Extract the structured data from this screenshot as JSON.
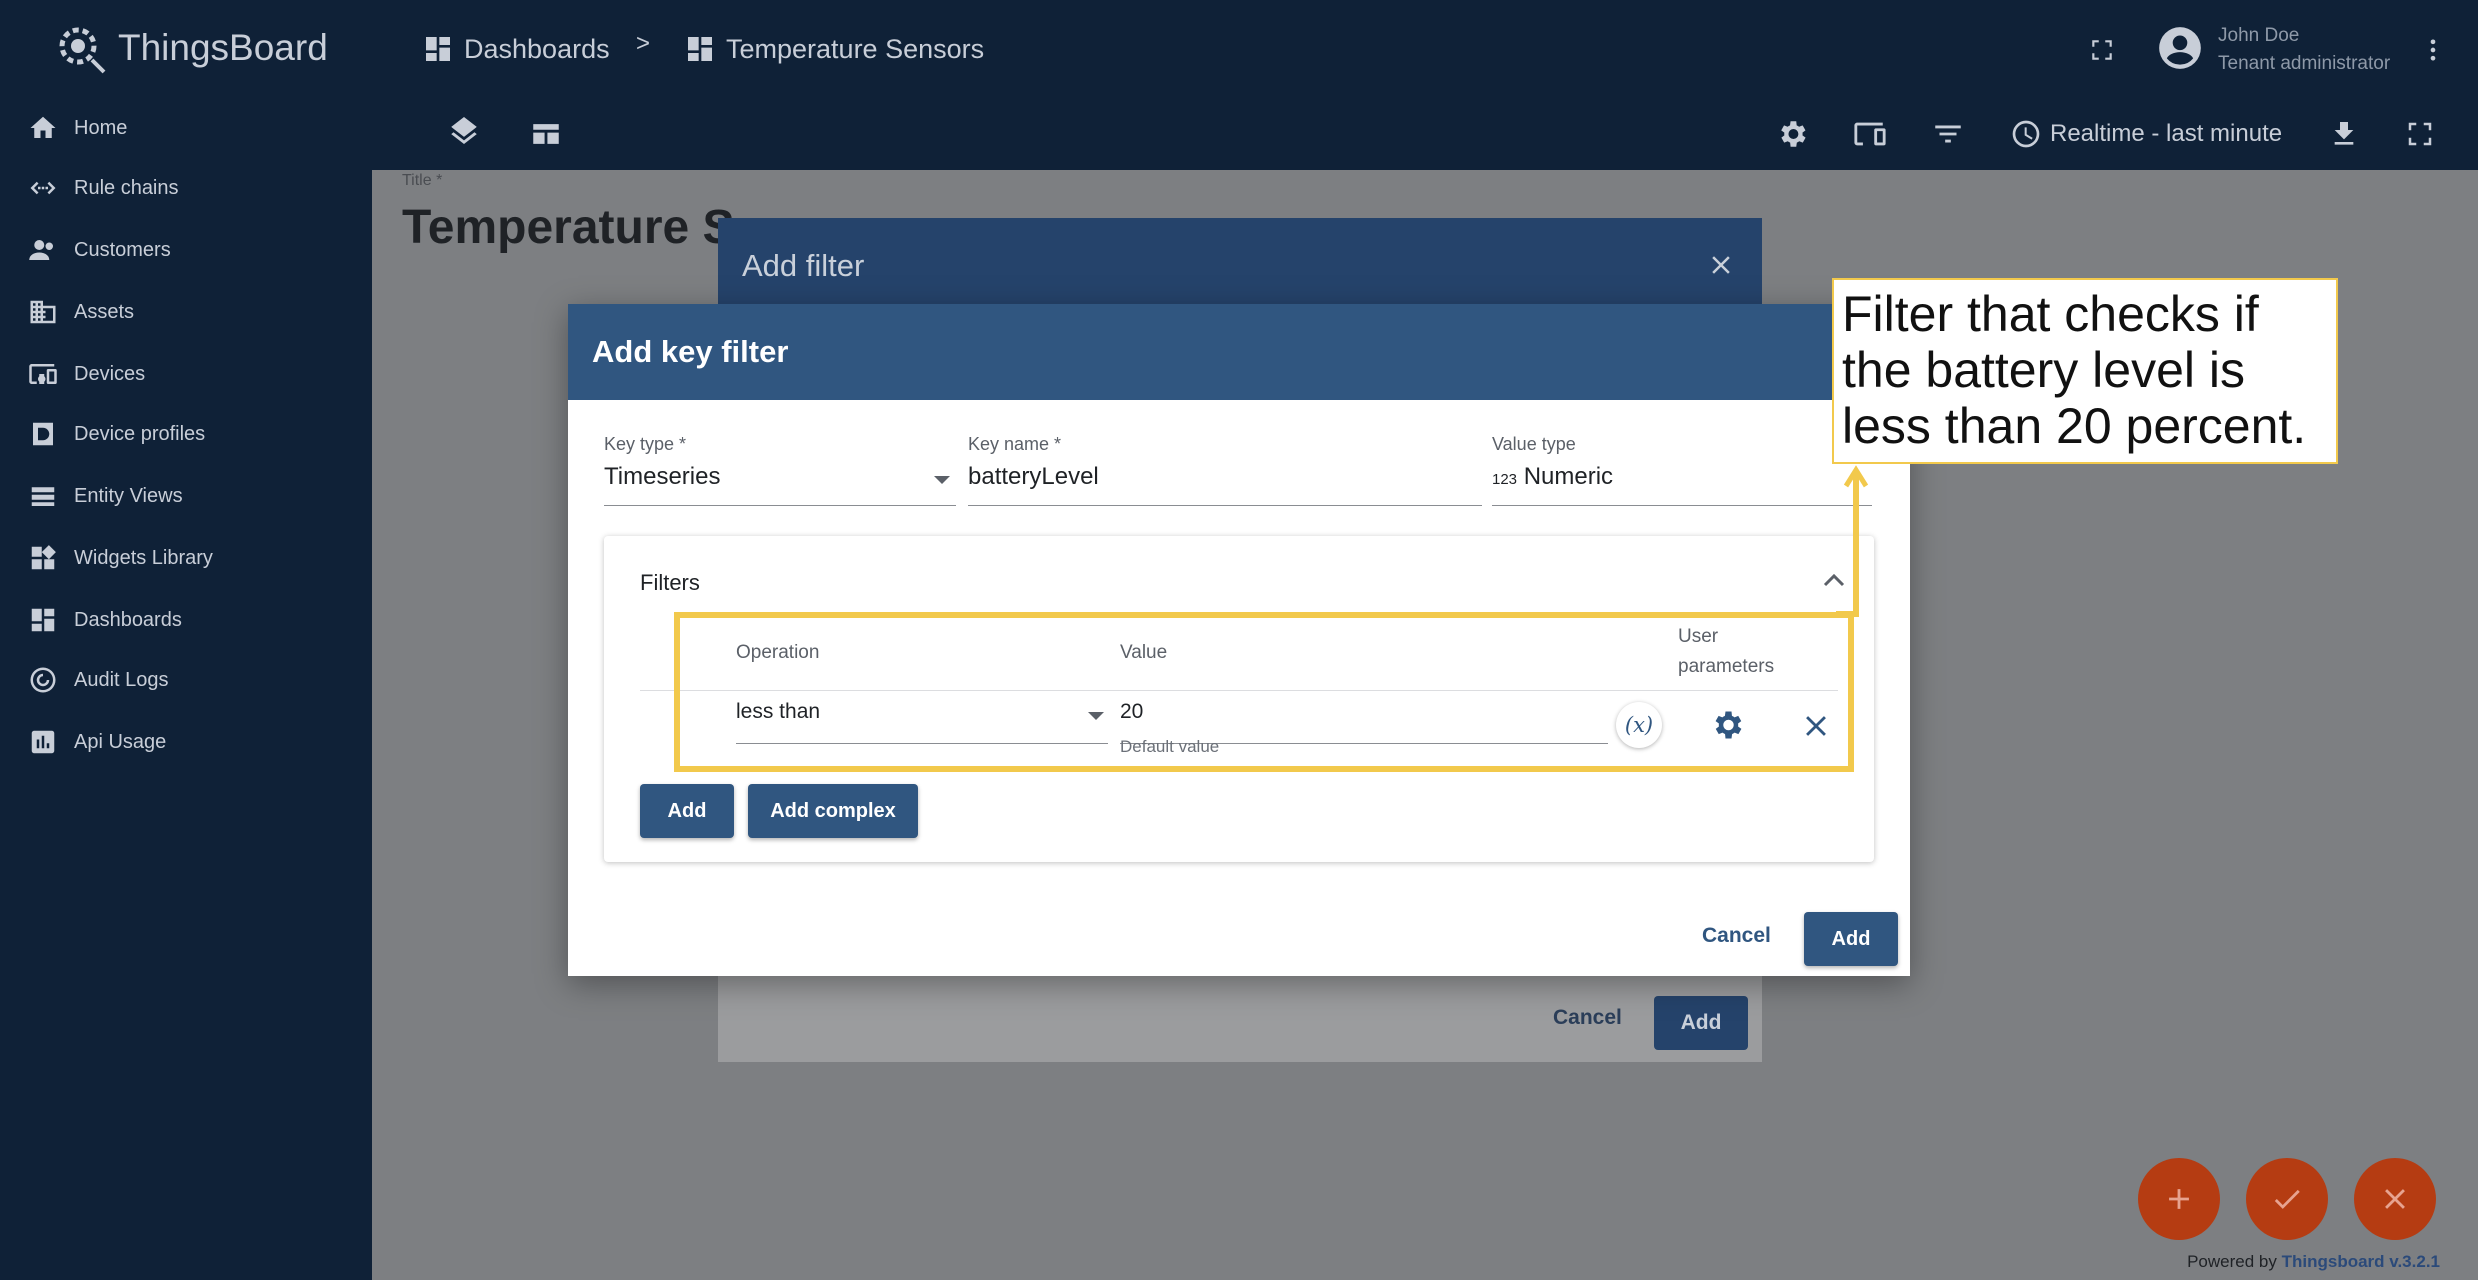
{
  "app": {
    "name": "ThingsBoard"
  },
  "sidebar": {
    "items": [
      {
        "label": "Home",
        "icon": "home-icon"
      },
      {
        "label": "Rule chains",
        "icon": "rule-chains-icon"
      },
      {
        "label": "Customers",
        "icon": "customers-icon"
      },
      {
        "label": "Assets",
        "icon": "assets-icon"
      },
      {
        "label": "Devices",
        "icon": "devices-icon"
      },
      {
        "label": "Device profiles",
        "icon": "device-profiles-icon"
      },
      {
        "label": "Entity Views",
        "icon": "entity-views-icon"
      },
      {
        "label": "Widgets Library",
        "icon": "widgets-icon"
      },
      {
        "label": "Dashboards",
        "icon": "dashboards-icon"
      },
      {
        "label": "Audit Logs",
        "icon": "audit-logs-icon"
      },
      {
        "label": "Api Usage",
        "icon": "api-usage-icon"
      }
    ]
  },
  "header": {
    "breadcrumb": [
      "Dashboards",
      "Temperature Sensors"
    ],
    "separator": ">",
    "user": {
      "name": "John Doe",
      "role": "Tenant administrator"
    },
    "timewindow": "Realtime - last minute"
  },
  "dashboard": {
    "title_label": "Title *",
    "title_value": "Temperature S"
  },
  "back_dialog": {
    "title": "Add filter",
    "cancel": "Cancel",
    "add": "Add"
  },
  "key_filter_dialog": {
    "title": "Add key filter",
    "key_type": {
      "label": "Key type *",
      "value": "Timeseries"
    },
    "key_name": {
      "label": "Key name *",
      "value": "batteryLevel"
    },
    "value_type": {
      "label": "Value type",
      "prefix": "123",
      "value": "Numeric"
    },
    "filters": {
      "title": "Filters",
      "columns": {
        "operation": "Operation",
        "value": "Value",
        "user_params": "User parameters"
      },
      "row": {
        "operation": "less than",
        "value": "20",
        "hint": "Default value",
        "dynamic_label": "(x)"
      },
      "add": "Add",
      "add_complex": "Add complex"
    },
    "cancel": "Cancel",
    "add": "Add"
  },
  "annotation": {
    "text": "Filter that checks if the battery level is less than 20 percent."
  },
  "footer": {
    "powered_prefix": "Powered by",
    "powered_link": "Thingsboard v.3.2.1"
  },
  "colors": {
    "primary": "#305680",
    "accent": "#b53c12",
    "highlight": "#f2c94c",
    "sidebar": "#0f2137"
  }
}
